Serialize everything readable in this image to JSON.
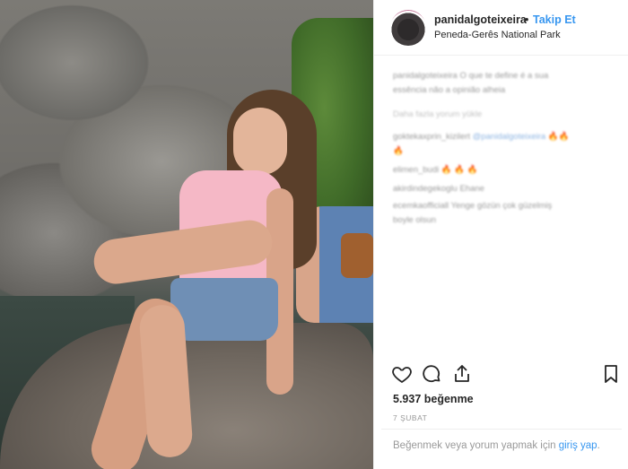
{
  "post": {
    "username": "panidalgoteixeira",
    "separator": "•",
    "follow_label": "Takip Et",
    "location": "Peneda-Gerês National Park"
  },
  "comments": [
    {
      "text": "panidalgoteixeira O que te define é a sua",
      "style": "normal"
    },
    {
      "text": "essência não a opinião alheia",
      "style": "normal"
    },
    {
      "text": "Daha fazla yorum yükle",
      "style": "light"
    },
    {
      "user": "goktekaxprin_kizilert",
      "mention": "@panidalgoteixeira",
      "emoji": "🔥🔥",
      "style": "normal"
    },
    {
      "text": "🔥",
      "style": "normal"
    },
    {
      "user": "elimen_budi",
      "emoji": "🔥 🔥 🔥",
      "style": "normal"
    },
    {
      "text": "akirdindegekoglu Ehane",
      "style": "normal"
    },
    {
      "text": "ecemkaofficiall Yenge gözün çok güzelmiş",
      "style": "normal"
    },
    {
      "text": "boyle olsun",
      "style": "normal"
    }
  ],
  "actions": {
    "like_icon": "heart-icon",
    "comment_icon": "comment-icon",
    "share_icon": "share-icon",
    "save_icon": "bookmark-icon"
  },
  "likes": "5.937 beğenme",
  "date": "7 ŞUBAT",
  "login": {
    "prefix": "Beğenmek veya yorum yapmak için",
    "link": "giriş yap",
    "suffix": "."
  },
  "colors": {
    "link": "#3897f0",
    "text": "#262626",
    "muted": "#999999"
  }
}
